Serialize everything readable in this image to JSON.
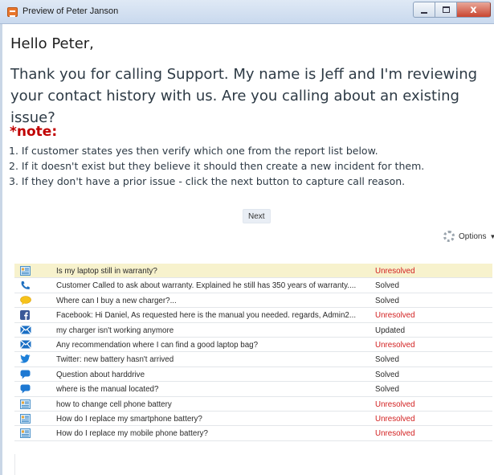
{
  "window": {
    "title": "Preview of Peter Janson",
    "close_glyph": "x"
  },
  "greeting": "Hello Peter,",
  "script": "Thank you for calling Support. My name is Jeff and I'm reviewing your contact history with us.  Are you calling about an existing issue?",
  "note": {
    "title": "*note:",
    "items": [
      "1. If customer states yes then verify which one from the report list below.",
      "2. If it doesn't exist but they believe it should then create a new incident for them.",
      "3. If they don't have a prior issue - click the next button to capture call reason."
    ]
  },
  "next_label": "Next",
  "options_label": "Options",
  "colors": {
    "unresolved": "#d21f1f",
    "note_red": "#c00000",
    "selected_row": "#f7f2cd"
  },
  "rows": [
    {
      "icon": "report-icon",
      "subject": "Is my laptop still in warranty?",
      "status": "Unresolved"
    },
    {
      "icon": "phone-icon",
      "subject": "Customer Called to ask about warranty. Explained he still has 350 years of warranty....",
      "status": "Solved"
    },
    {
      "icon": "chat-bubble-icon",
      "subject": "Where can I buy a new charger?...",
      "status": "Solved"
    },
    {
      "icon": "facebook-icon",
      "subject": "Facebook: Hi Daniel, As requested here is the manual you needed. regards, Admin2...",
      "status": "Unresolved"
    },
    {
      "icon": "email-icon",
      "subject": "my charger isn't working anymore",
      "status": "Updated"
    },
    {
      "icon": "email-icon",
      "subject": "Any recommendation where I can find a good laptop bag?",
      "status": "Unresolved"
    },
    {
      "icon": "twitter-icon",
      "subject": "Twitter: new battery hasn't arrived",
      "status": "Solved"
    },
    {
      "icon": "speech-bubble-icon",
      "subject": "Question about harddrive",
      "status": "Solved"
    },
    {
      "icon": "speech-bubble-icon",
      "subject": "where is the manual located?",
      "status": "Solved"
    },
    {
      "icon": "report-icon",
      "subject": "how to change cell phone battery",
      "status": "Unresolved"
    },
    {
      "icon": "report-icon",
      "subject": "How do I replace my smartphone battery?",
      "status": "Unresolved"
    },
    {
      "icon": "report-icon",
      "subject": "How do I replace my mobile phone battery?",
      "status": "Unresolved"
    }
  ]
}
